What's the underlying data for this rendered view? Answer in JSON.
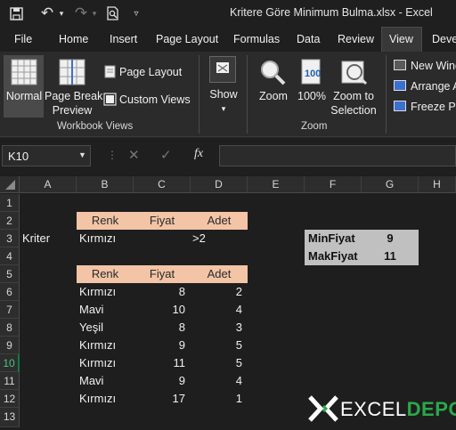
{
  "window": {
    "title": "Kritere Göre Minimum Bulma.xlsx  -  Excel"
  },
  "tabs": [
    "File",
    "Home",
    "Insert",
    "Page Layout",
    "Formulas",
    "Data",
    "Review",
    "View",
    "Deve"
  ],
  "ribbon": {
    "normal": "Normal",
    "page_break_1": "Page Break",
    "page_break_2": "Preview",
    "page_layout": "Page Layout",
    "custom_views": "Custom Views",
    "workbook_views": "Workbook Views",
    "show": "Show",
    "zoom": "Zoom",
    "zoom_100": "100%",
    "zoom_sel_1": "Zoom to",
    "zoom_sel_2": "Selection",
    "zoom_group": "Zoom",
    "new_window": "New Wind",
    "arrange_all": "Arrange A",
    "freeze_panes": "Freeze Par"
  },
  "formula_bar": {
    "name_box": "K10",
    "fx": "fx",
    "value": ""
  },
  "columns": [
    "A",
    "B",
    "C",
    "D",
    "E",
    "F",
    "G",
    "H"
  ],
  "rows": [
    "1",
    "2",
    "3",
    "4",
    "5",
    "6",
    "7",
    "8",
    "9",
    "10",
    "11",
    "12",
    "13"
  ],
  "criteria": {
    "headers": [
      "Renk",
      "Fiyat",
      "Adet"
    ],
    "label": "Kriter",
    "renk": "Kırmızı",
    "adet": ">2"
  },
  "table": {
    "headers": [
      "Renk",
      "Fiyat",
      "Adet"
    ],
    "rows": [
      [
        "Kırmızı",
        "8",
        "2"
      ],
      [
        "Mavi",
        "10",
        "4"
      ],
      [
        "Yeşil",
        "8",
        "3"
      ],
      [
        "Kırmızı",
        "9",
        "5"
      ],
      [
        "Kırmızı",
        "11",
        "5"
      ],
      [
        "Mavi",
        "9",
        "4"
      ],
      [
        "Kırmızı",
        "17",
        "1"
      ]
    ]
  },
  "results": {
    "min_label": "MinFiyat",
    "min_value": "9",
    "max_label": "MakFiyat",
    "max_value": "11"
  },
  "logo": {
    "text1": "EXCEL",
    "text2": "DEPO"
  },
  "colors": {
    "header_fill": "#f3c4a6",
    "result_fill": "#c0c0c0",
    "selected": "#107c41"
  }
}
